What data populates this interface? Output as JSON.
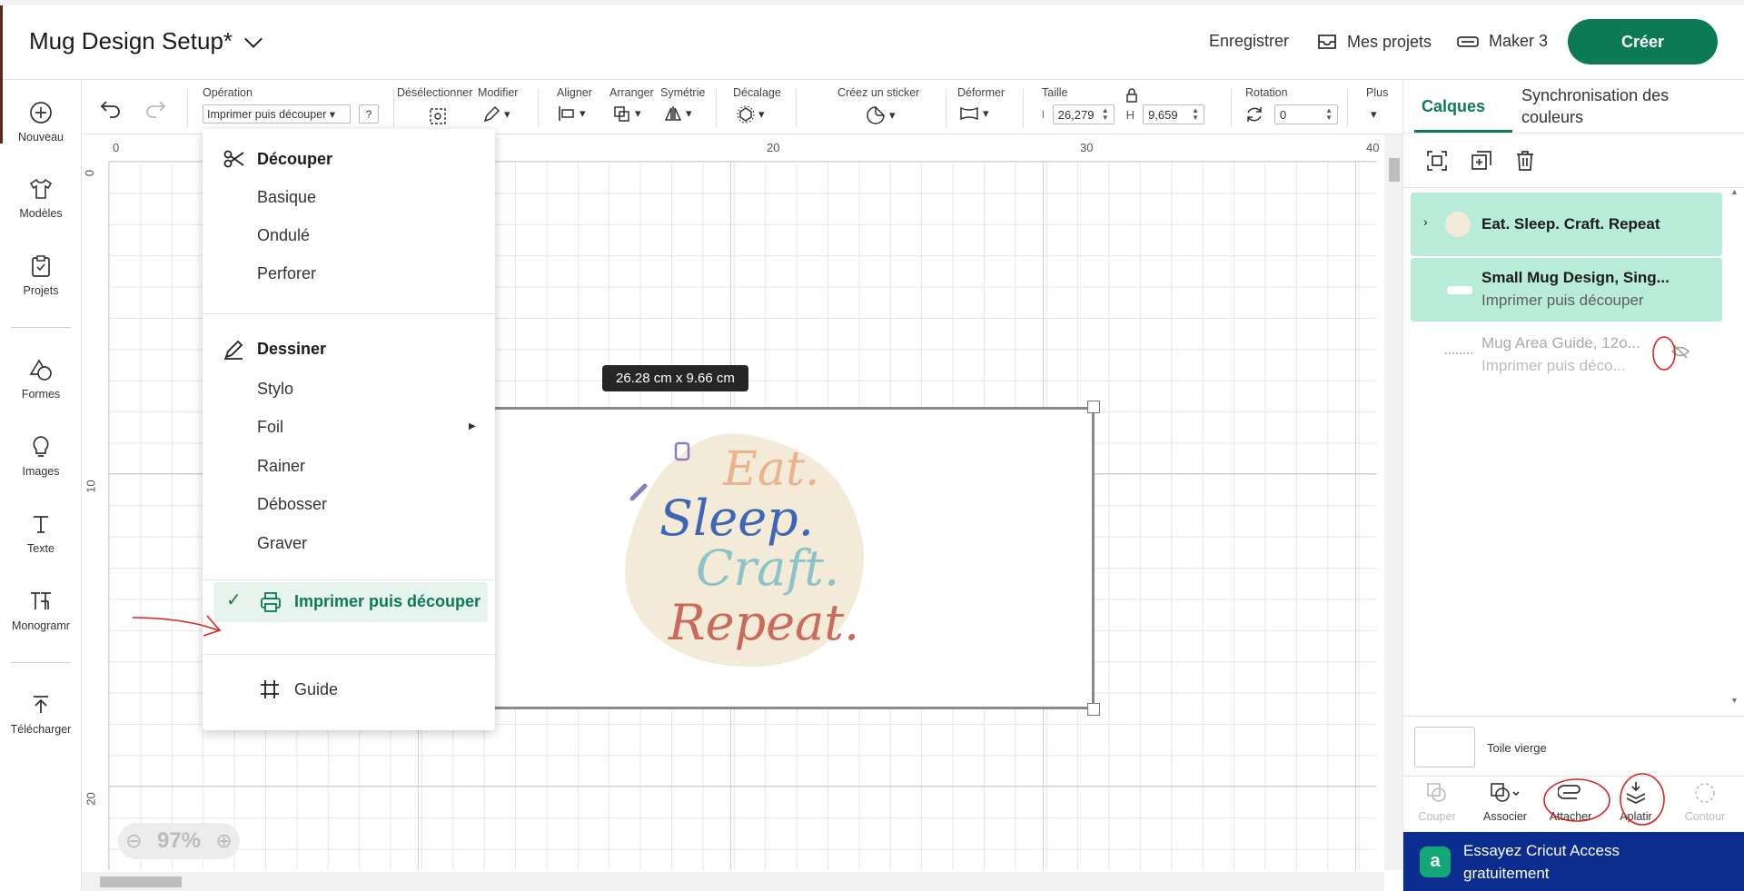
{
  "header": {
    "project_title": "Mug Design Setup*",
    "save_label": "Enregistrer",
    "projects_label": "Mes projets",
    "machine_label": "Maker 3",
    "create_label": "Créer"
  },
  "sidebar": {
    "items": [
      {
        "label": "Nouveau",
        "icon": "plus-circle-icon"
      },
      {
        "label": "Modèles",
        "icon": "tshirt-icon"
      },
      {
        "label": "Projets",
        "icon": "project-icon"
      },
      {
        "label": "Formes",
        "icon": "shapes-icon"
      },
      {
        "label": "Images",
        "icon": "lightbulb-icon"
      },
      {
        "label": "Texte",
        "icon": "text-icon"
      },
      {
        "label": "Monogramr",
        "icon": "monogram-icon"
      },
      {
        "label": "Télécharger",
        "icon": "upload-icon"
      }
    ]
  },
  "toolbar": {
    "operation_label": "Opération",
    "operation_value": "Imprimer puis découper",
    "help_label": "?",
    "deselect_label": "Désélectionner",
    "edit_label": "Modifier",
    "align_label": "Aligner",
    "arrange_label": "Arranger",
    "symmetry_label": "Symétrie",
    "offset_label": "Décalage",
    "sticker_label": "Créez un sticker",
    "warp_label": "Déformer",
    "size_label": "Taille",
    "width_prefix": "l",
    "width_value": "26,279",
    "height_prefix": "H",
    "height_value": "9,659",
    "rotation_label": "Rotation",
    "rotation_value": "0",
    "more_label": "Plus"
  },
  "canvas": {
    "ruler_top": [
      "0",
      "20",
      "30",
      "40"
    ],
    "ruler_left": [
      "0",
      "10",
      "20"
    ],
    "dimension_tooltip": "26.28  cm x 9.66  cm",
    "zoom_level": "97%",
    "design_text": [
      "Eat.",
      "Sleep.",
      "Craft.",
      "Repeat."
    ]
  },
  "operation_menu": {
    "cut_header": "Découper",
    "cut_items": [
      "Basique",
      "Ondulé",
      "Perforer"
    ],
    "draw_header": "Dessiner",
    "draw_items": [
      "Stylo",
      "Foil",
      "Rainer",
      "Débosser",
      "Graver"
    ],
    "selected_item": "Imprimer puis découper",
    "guide_item": "Guide"
  },
  "right_panel": {
    "tabs": [
      "Calques",
      "Synchronisation des couleurs"
    ],
    "layers": [
      {
        "title": "Eat. Sleep. Craft. Repeat",
        "subtitle": ""
      },
      {
        "title": "Small Mug Design, Sing...",
        "subtitle": "Imprimer puis découper"
      },
      {
        "title": "Mug Area Guide, 12o...",
        "subtitle": "Imprimer puis déco..."
      }
    ],
    "blank_canvas_label": "Toile vierge",
    "bottom_tools": [
      "Couper",
      "Associer",
      "Attacher",
      "Aplatir",
      "Contour"
    ],
    "access_banner": "Essayez Cricut Access gratuitement"
  },
  "colors": {
    "brand_green": "#0b7a55",
    "access_blue": "#0b2d8f",
    "layer_selected": "#b8ecd8"
  }
}
